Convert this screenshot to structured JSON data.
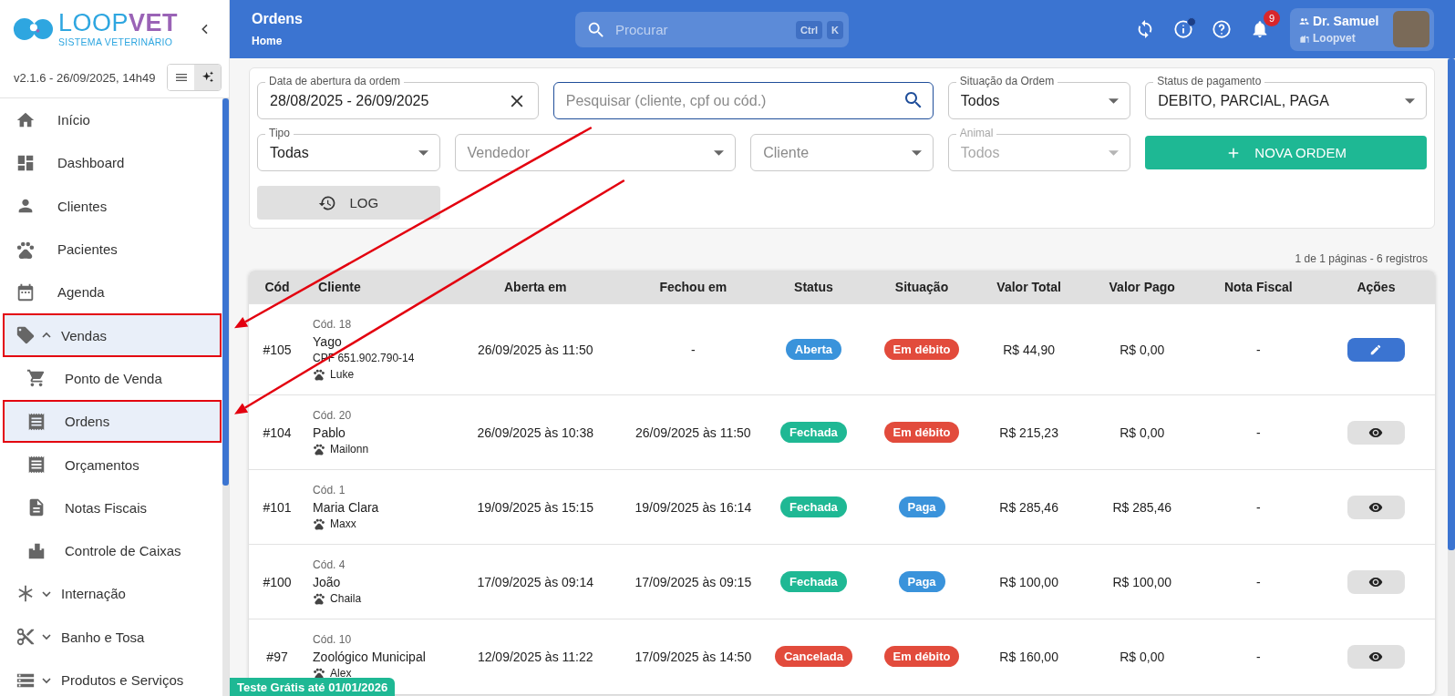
{
  "sidebar": {
    "logo": {
      "wordmark_first": "LOOP",
      "wordmark_second": "VET",
      "tagline": "SISTEMA VETERINÁRIO"
    },
    "version": "v2.1.6 - 26/09/2025, 14h49",
    "view_toggle": [
      {
        "selected": false
      },
      {
        "selected": true
      }
    ],
    "items": [
      {
        "kind": "link",
        "label": "Início",
        "selected": false,
        "annotated": false
      },
      {
        "kind": "link",
        "label": "Dashboard",
        "selected": false,
        "annotated": false
      },
      {
        "kind": "link",
        "label": "Clientes",
        "selected": false,
        "annotated": false
      },
      {
        "kind": "link",
        "label": "Pacientes",
        "selected": false,
        "annotated": false
      },
      {
        "kind": "link",
        "label": "Agenda",
        "selected": false,
        "annotated": false
      },
      {
        "kind": "group",
        "label": "Vendas",
        "selected": true,
        "annotated": true,
        "expanded": true,
        "children": [
          {
            "label": "Ponto de Venda",
            "selected": false,
            "annotated": false
          },
          {
            "label": "Ordens",
            "selected": true,
            "annotated": true
          },
          {
            "label": "Orçamentos",
            "selected": false,
            "annotated": false
          },
          {
            "label": "Notas Fiscais",
            "selected": false,
            "annotated": false
          },
          {
            "label": "Controle de Caixas",
            "selected": false,
            "annotated": false
          }
        ]
      },
      {
        "kind": "group",
        "label": "Internação",
        "selected": false,
        "annotated": false,
        "expanded": false
      },
      {
        "kind": "group",
        "label": "Banho e Tosa",
        "selected": false,
        "annotated": false,
        "expanded": false
      },
      {
        "kind": "group",
        "label": "Produtos e Serviços",
        "selected": false,
        "annotated": false,
        "expanded": false
      }
    ]
  },
  "header": {
    "title": "Ordens",
    "breadcrumb": "Home",
    "search": {
      "placeholder": "Procurar",
      "shortcut": [
        "Ctrl",
        "K"
      ]
    },
    "info_unread": true,
    "notifications": "9",
    "user": {
      "name": "Dr. Samuel",
      "organization": "Loopvet"
    }
  },
  "filters": [
    {
      "kind": "date",
      "label": "Data de abertura da ordem",
      "value": "28/08/2025 - 26/09/2025"
    },
    {
      "kind": "search",
      "placeholder": "Pesquisar (cliente, cpf ou cód.)",
      "focused": true
    },
    {
      "kind": "select",
      "label": "Situação da Ordem",
      "value": "Todos",
      "disabled": false
    },
    {
      "kind": "select",
      "label": "Status de pagamento",
      "value": "DEBITO, PARCIAL, PAGA",
      "disabled": false
    },
    {
      "kind": "select",
      "label": "Tipo",
      "value": "Todas",
      "disabled": false
    },
    {
      "kind": "select",
      "placeholder": "Vendedor",
      "disabled": false
    },
    {
      "kind": "select",
      "placeholder": "Cliente",
      "disabled": false
    },
    {
      "kind": "select",
      "label": "Animal",
      "value": "Todos",
      "disabled": true
    },
    {
      "kind": "create",
      "label": "NOVA ORDEM"
    },
    {
      "kind": "history",
      "label": "LOG"
    }
  ],
  "pagination": "1 de 1 páginas - 6 registros",
  "table": {
    "columns": [
      "Cód",
      "Cliente",
      "Aberta em",
      "Fechou em",
      "Status",
      "Situação",
      "Valor Total",
      "Valor Pago",
      "Nota Fiscal",
      "Ações"
    ],
    "rows": [
      {
        "code": "#105",
        "client": {
          "code": "Cód. 18",
          "name": "Yago",
          "document": "CPF 651.902.790-14",
          "pet": "Luke"
        },
        "opened": "26/09/2025 às 11:50",
        "closed": "-",
        "status": {
          "label": "Aberta",
          "color": "#3a93db"
        },
        "situation": {
          "label": "Em débito",
          "color": "#e24b3c"
        },
        "total": "R$ 44,90",
        "paid": "R$ 0,00",
        "invoice": "-",
        "action": {
          "kind": "edit"
        }
      },
      {
        "code": "#104",
        "client": {
          "code": "Cód. 20",
          "name": "Pablo",
          "pet": "Mailonn"
        },
        "opened": "26/09/2025 às 10:38",
        "closed": "26/09/2025 às 11:50",
        "status": {
          "label": "Fechada",
          "color": "#1fb894"
        },
        "situation": {
          "label": "Em débito",
          "color": "#e24b3c"
        },
        "total": "R$ 215,23",
        "paid": "R$ 0,00",
        "invoice": "-",
        "action": {
          "kind": "view"
        }
      },
      {
        "code": "#101",
        "client": {
          "code": "Cód. 1",
          "name": "Maria Clara",
          "pet": "Maxx"
        },
        "opened": "19/09/2025 às 15:15",
        "closed": "19/09/2025 às 16:14",
        "status": {
          "label": "Fechada",
          "color": "#1fb894"
        },
        "situation": {
          "label": "Paga",
          "color": "#3a93db"
        },
        "total": "R$ 285,46",
        "paid": "R$ 285,46",
        "invoice": "-",
        "action": {
          "kind": "view"
        }
      },
      {
        "code": "#100",
        "client": {
          "code": "Cód. 4",
          "name": "João",
          "pet": "Chaila"
        },
        "opened": "17/09/2025 às 09:14",
        "closed": "17/09/2025 às 09:15",
        "status": {
          "label": "Fechada",
          "color": "#1fb894"
        },
        "situation": {
          "label": "Paga",
          "color": "#3a93db"
        },
        "total": "R$ 100,00",
        "paid": "R$ 100,00",
        "invoice": "-",
        "action": {
          "kind": "view"
        }
      },
      {
        "code": "#97",
        "client": {
          "code": "Cód. 10",
          "name": "Zoológico Municipal",
          "pet": "Alex"
        },
        "opened": "12/09/2025 às 11:22",
        "closed": "17/09/2025 às 14:50",
        "status": {
          "label": "Cancelada",
          "color": "#e24b3c"
        },
        "situation": {
          "label": "Em débito",
          "color": "#e24b3c"
        },
        "total": "R$ 160,00",
        "paid": "R$ 0,00",
        "invoice": "-",
        "action": {
          "kind": "view"
        }
      }
    ]
  },
  "trial_badge": "Teste Grátis até 01/01/2026"
}
